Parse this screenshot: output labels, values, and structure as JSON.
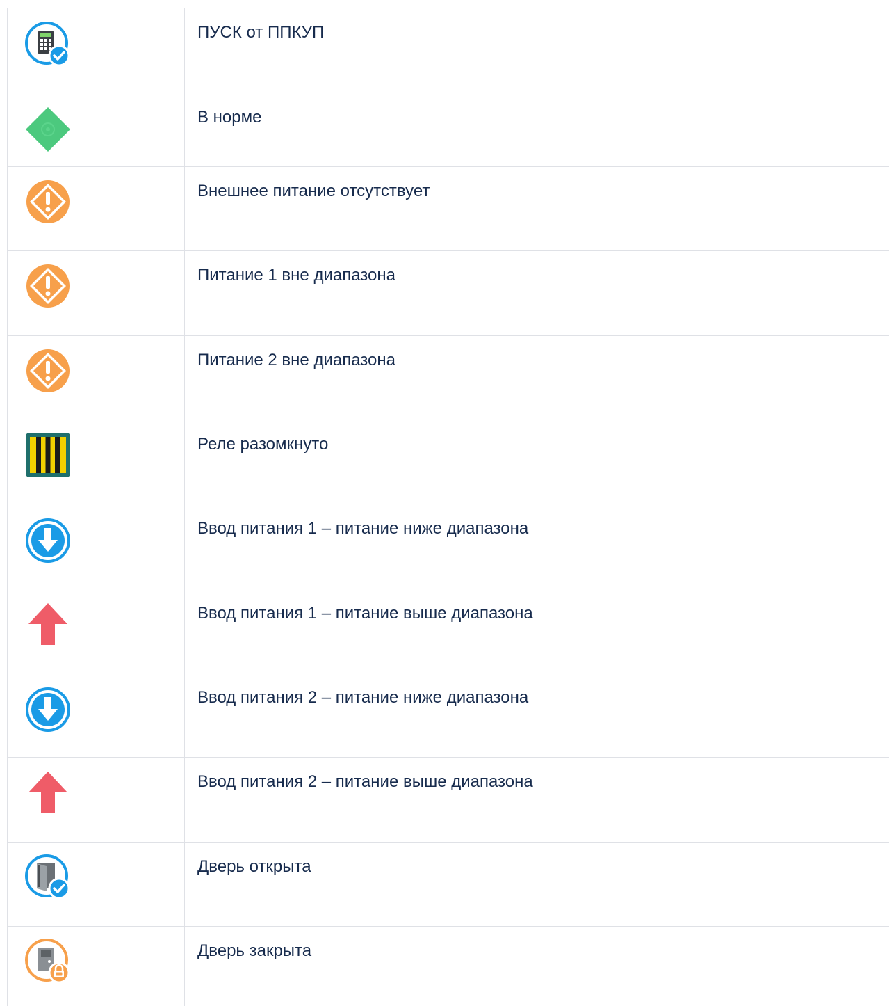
{
  "rows": [
    {
      "icon": "keypad-check-icon",
      "text": "ПУСК от ППКУП"
    },
    {
      "icon": "green-diamond-icon",
      "text": "В норме"
    },
    {
      "icon": "warning-diamond-icon",
      "text": "Внешнее питание отсутствует"
    },
    {
      "icon": "warning-diamond-icon",
      "text": "Питание 1 вне диапазона"
    },
    {
      "icon": "warning-diamond-icon",
      "text": "Питание 2 вне диапазона"
    },
    {
      "icon": "relay-open-icon",
      "text": "Реле разомкнуто"
    },
    {
      "icon": "arrow-down-circle-icon",
      "text": "Ввод питания 1 – питание ниже диапазона"
    },
    {
      "icon": "arrow-up-red-icon",
      "text": "Ввод питания 1 – питание выше диапазона"
    },
    {
      "icon": "arrow-down-circle-icon",
      "text": "Ввод питания 2 – питание ниже диапазона"
    },
    {
      "icon": "arrow-up-red-icon",
      "text": "Ввод питания 2 – питание выше диапазона"
    },
    {
      "icon": "door-open-icon",
      "text": "Дверь открыта"
    },
    {
      "icon": "door-locked-icon",
      "text": "Дверь закрыта"
    }
  ],
  "colors": {
    "border": "#dfe1e6",
    "text": "#172b4d",
    "green": "#4cc97e",
    "orange": "#f7a04b",
    "blue": "#1a9be6",
    "red": "#ef5c68",
    "relay_bg": "#1f6f6c",
    "relay_yellow": "#f2d000"
  }
}
